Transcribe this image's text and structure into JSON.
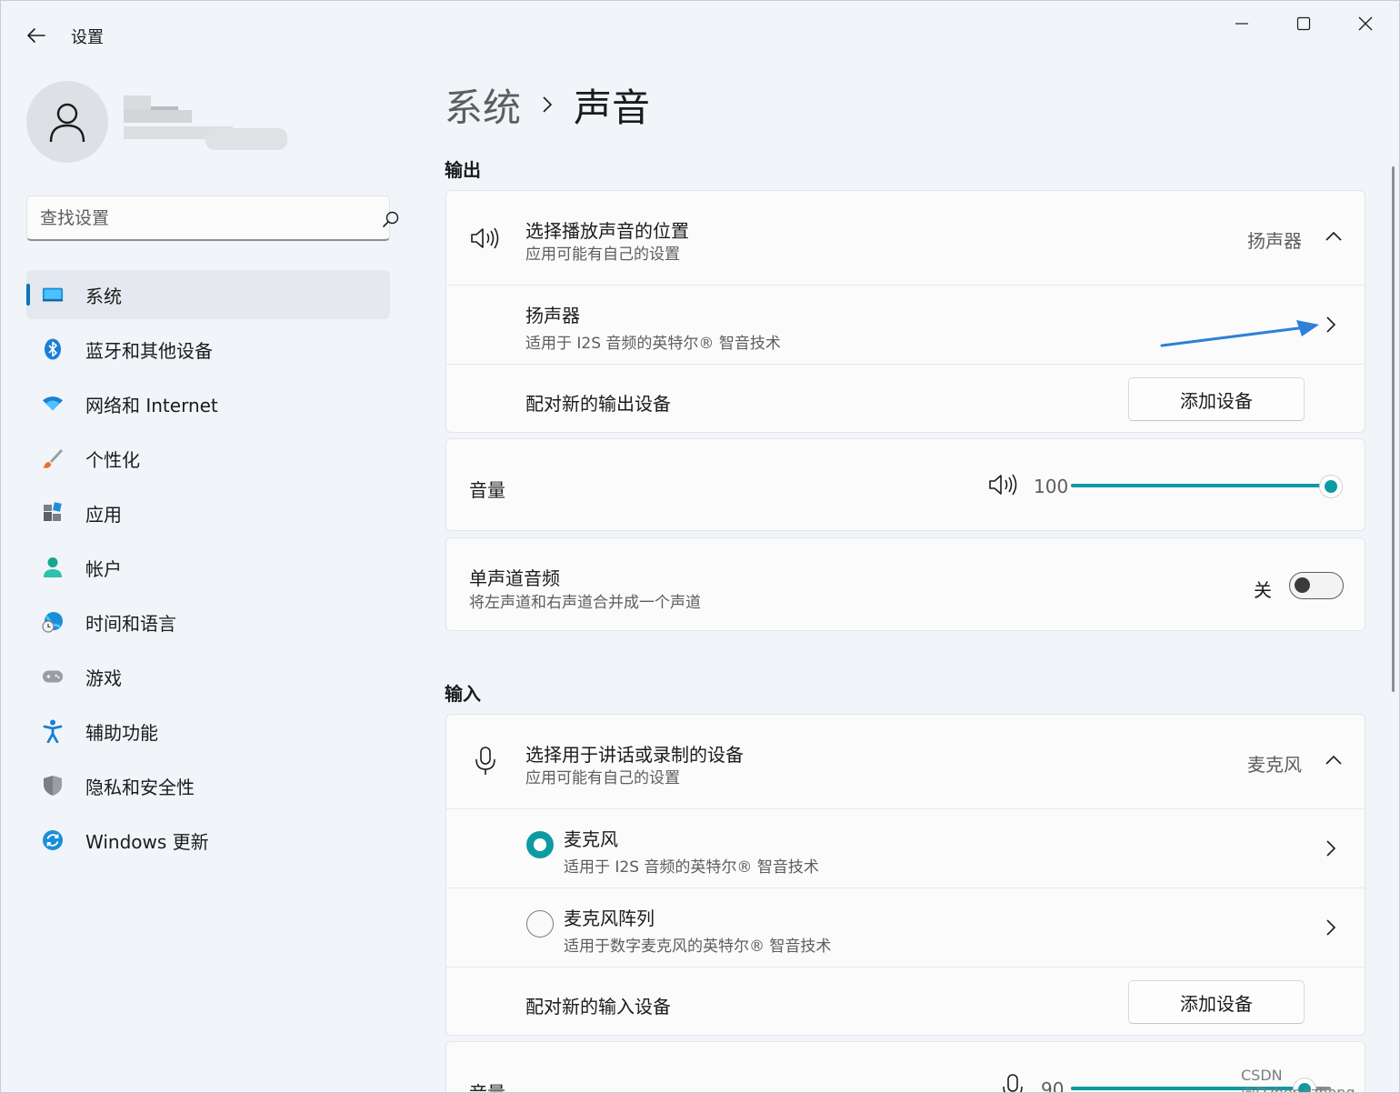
{
  "window": {
    "title": "设置"
  },
  "search": {
    "placeholder": "查找设置"
  },
  "sidebar": {
    "items": [
      {
        "label": "系统",
        "active": true
      },
      {
        "label": "蓝牙和其他设备"
      },
      {
        "label": "网络和 Internet"
      },
      {
        "label": "个性化"
      },
      {
        "label": "应用"
      },
      {
        "label": "帐户"
      },
      {
        "label": "时间和语言"
      },
      {
        "label": "游戏"
      },
      {
        "label": "辅助功能"
      },
      {
        "label": "隐私和安全性"
      },
      {
        "label": "Windows 更新"
      }
    ]
  },
  "breadcrumb": {
    "parent": "系统",
    "current": "声音"
  },
  "output": {
    "section_title": "输出",
    "choose_title": "选择播放声音的位置",
    "choose_sub": "应用可能有自己的设置",
    "choose_value": "扬声器",
    "device_name": "扬声器",
    "device_sub": "适用于 I2S 音频的英特尔® 智音技术",
    "pair_label": "配对新的输出设备",
    "add_button": "添加设备",
    "volume_label": "音量",
    "volume_value": "100",
    "volume_fraction": 1.0,
    "mono_title": "单声道音频",
    "mono_sub": "将左声道和右声道合并成一个声道",
    "mono_state": "关"
  },
  "input": {
    "section_title": "输入",
    "choose_title": "选择用于讲话或录制的设备",
    "choose_sub": "应用可能有自己的设置",
    "choose_value": "麦克风",
    "device1_name": "麦克风",
    "device1_sub": "适用于 I2S 音频的英特尔® 智音技术",
    "device2_name": "麦克风阵列",
    "device2_sub": "适用于数字麦克风的英特尔® 智音技术",
    "pair_label": "配对新的输入设备",
    "add_button": "添加设备",
    "volume_label": "音量",
    "volume_value": "90",
    "volume_fraction": 0.9
  },
  "colors": {
    "accent": "#0e9aa3",
    "nav_indicator": "#0b77b6",
    "annotation_arrow": "#2f80d8"
  },
  "watermark": "CSDN @Dzhongzhong"
}
